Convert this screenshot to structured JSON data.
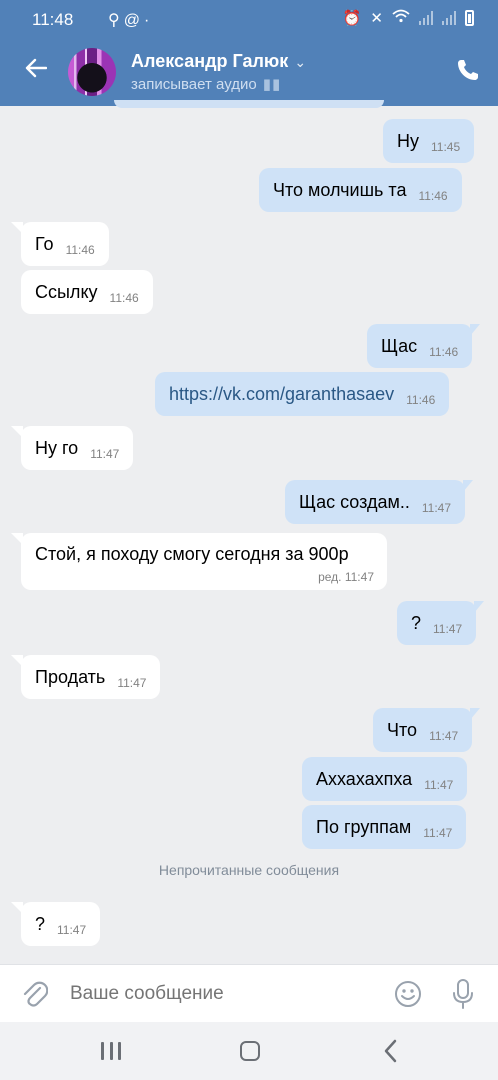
{
  "status_bar": {
    "time": "11:48"
  },
  "header": {
    "contact_name": "Александр Галюк",
    "contact_status": "записывает аудио"
  },
  "messages": [
    {
      "text": "Ну",
      "time": "11:45",
      "direction": "out"
    },
    {
      "text": "Что молчишь та",
      "time": "11:46",
      "direction": "out"
    },
    {
      "text": "Го",
      "time": "11:46",
      "direction": "in"
    },
    {
      "text": "Ссылку",
      "time": "11:46",
      "direction": "in"
    },
    {
      "text": "Щас",
      "time": "11:46",
      "direction": "out"
    },
    {
      "text": "https://vk.com/garanthasaev",
      "time": "11:46",
      "direction": "out"
    },
    {
      "text": "Ну го",
      "time": "11:47",
      "direction": "in"
    },
    {
      "text": "Щас создам..",
      "time": "11:47",
      "direction": "out"
    },
    {
      "text": "Стой, я походу смогу сегодня за 900р",
      "time": "ред. 11:47",
      "direction": "in"
    },
    {
      "text": "?",
      "time": "11:47",
      "direction": "out"
    },
    {
      "text": "Продать",
      "time": "11:47",
      "direction": "in"
    },
    {
      "text": "Что",
      "time": "11:47",
      "direction": "out"
    },
    {
      "text": "Аххахахпха",
      "time": "11:47",
      "direction": "out"
    },
    {
      "text": "По группам",
      "time": "11:47",
      "direction": "out"
    },
    {
      "text": "?",
      "time": "11:47",
      "direction": "in"
    }
  ],
  "unread_divider": "Непрочитанные сообщения",
  "composer": {
    "placeholder": "Ваше сообщение"
  },
  "colors": {
    "header": "#5181b8",
    "outgoing_bubble": "#cfe2f7",
    "incoming_bubble": "#ffffff",
    "background": "#edeef0"
  }
}
